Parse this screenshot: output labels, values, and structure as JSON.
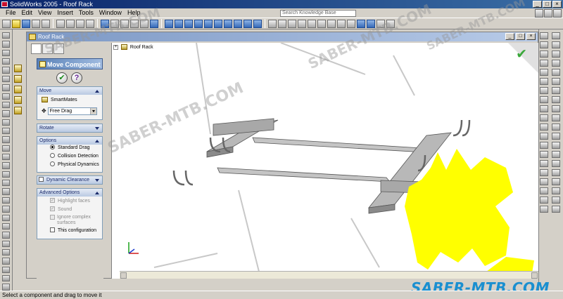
{
  "window": {
    "title": "SolidWorks 2005 - Roof Rack"
  },
  "menu": {
    "items": [
      "File",
      "Edit",
      "View",
      "Insert",
      "Tools",
      "Window",
      "Help"
    ]
  },
  "toolbar": {
    "search_placeholder": "Search Knowledge Base"
  },
  "document": {
    "title": "Roof Rack",
    "tree_root": "Roof Rack"
  },
  "property_manager": {
    "title": "Move Component",
    "ok_symbol": "✔",
    "help_symbol": "?",
    "move_group": {
      "label": "Move",
      "smartmates_label": "SmartMates",
      "drag_mode_value": "Free Drag"
    },
    "rotate_group": {
      "label": "Rotate"
    },
    "options_group": {
      "label": "Options",
      "standard_drag": "Standard Drag",
      "collision_detection": "Collision Detection",
      "physical_dynamics": "Physical Dynamics"
    },
    "dynamic_clearance_group": {
      "label": "Dynamic Clearance"
    },
    "advanced_group": {
      "label": "Advanced Options",
      "highlight_faces": "Highlight faces",
      "sound": "Sound",
      "ignore_complex": "Ignore complex surfaces",
      "this_configuration": "This configuration"
    }
  },
  "viewport": {
    "confirm_symbol": "✔"
  },
  "status": {
    "text": "Select a component and drag to move it"
  },
  "watermark": {
    "text": "SABER-MTB.COM",
    "footer_text": "SABER-MTB.COM"
  },
  "colors": {
    "logo_yellow": "#ffff00",
    "footer_blue": "#1a8fd0",
    "model_gray": "#b0b0b0"
  }
}
